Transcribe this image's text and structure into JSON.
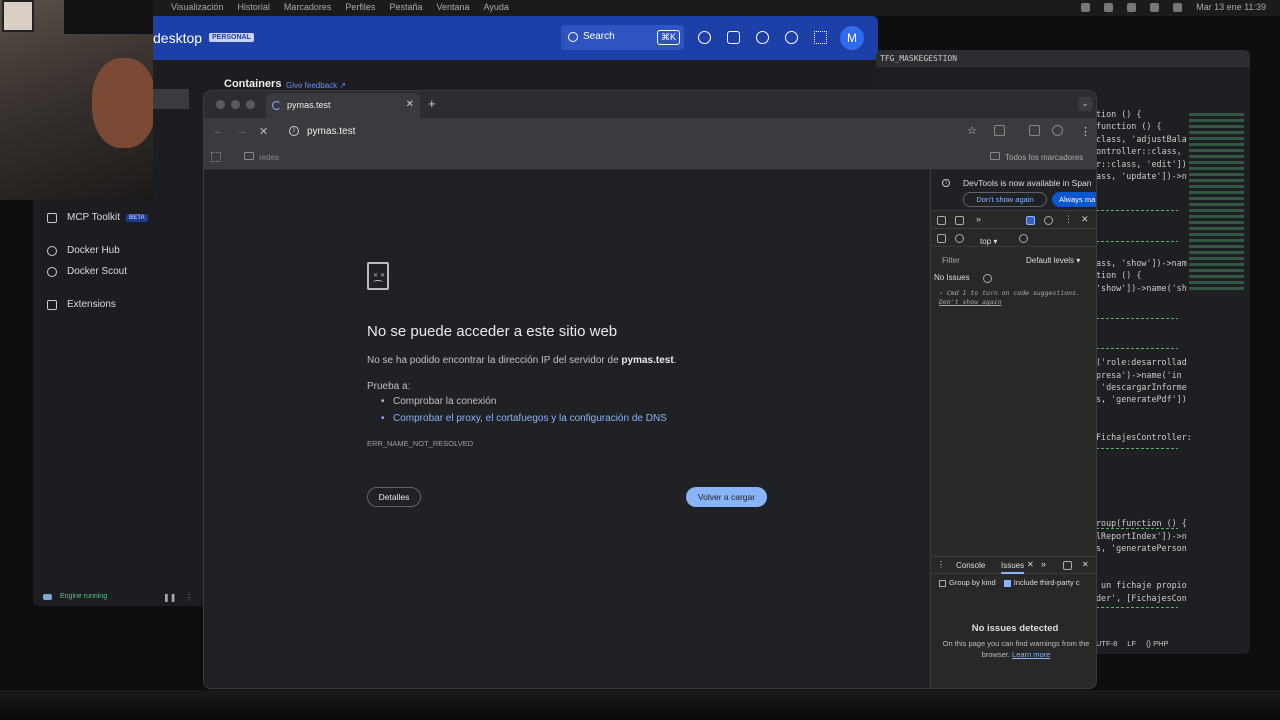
{
  "menubar": {
    "menus": [
      "Visualización",
      "Historial",
      "Marcadores",
      "Perfiles",
      "Pestaña",
      "Ventana",
      "Ayuda"
    ],
    "datetime": "Mar 13 ene  11:39"
  },
  "docker": {
    "brand": "desktop",
    "plan_badge": "PERSONAL",
    "search_label": "Search",
    "search_shortcut": "⌘K",
    "avatar_letter": "M",
    "section_title": "Containers",
    "feedback_link": "Give feedback ↗",
    "nav": [
      {
        "label": "MCP Toolkit",
        "badge": "BETA"
      },
      {
        "label": "Docker Hub"
      },
      {
        "label": "Docker Scout"
      },
      {
        "label": "Extensions"
      }
    ],
    "engine_status": "Engine running"
  },
  "editor": {
    "tab_name": "TFG_MASKEGESTION",
    "code_lines": [
      "tion () {",
      "function () {",
      "class, 'adjustBala",
      "ontroller::class,",
      "r::class, 'edit'])",
      "ass, 'update'])->n",
      "",
      "",
      "",
      "",
      "",
      "",
      "ass, 'show'])->nam",
      "tion () {",
      "'show'])->name('sh",
      "",
      "",
      "",
      "",
      "",
      "('role:desarrollad",
      "presa')->name('in",
      " 'descargarInforme",
      "s, 'generatePdf'])",
      "",
      "",
      "FichajesController:",
      "",
      "",
      "",
      "",
      "",
      "",
      "roup(function () {",
      "lReportIndex'])->n",
      "s, 'generatePerson",
      "",
      "",
      " un fichaje propio",
      "der', [FichajesCon",
      "",
      "",
      "",
      "",
      "",
      "_admin')->group(fu"
    ],
    "status_items": [
      "UTF-8",
      "LF",
      "{} PHP"
    ]
  },
  "chrome": {
    "tab_title": "pymas.test",
    "url": "pymas.test",
    "bookmark_folder": "redes",
    "all_bookmarks": "Todos los marcadores"
  },
  "error_page": {
    "title": "No se puede acceder a este sitio web",
    "desc_prefix": "No se ha podido encontrar la dirección IP del servidor de ",
    "host": "pymas.test",
    "desc_suffix": ".",
    "try_label": "Prueba a:",
    "suggestions": [
      "Comprobar la conexión",
      "Comprobar el proxy, el cortafuegos y la configuración de DNS"
    ],
    "error_code": "ERR_NAME_NOT_RESOLVED",
    "details_button": "Detalles",
    "reload_button": "Volver a cargar"
  },
  "devtools": {
    "banner_text": "DevTools is now available in Span",
    "dont_show": "Don't show again",
    "always": "Always ma",
    "context": "top ▾",
    "filter_placeholder": "Filter",
    "levels": "Default levels ▾",
    "no_issues": "No Issues",
    "hint_key": "Cmd",
    "hint_key2": "I",
    "hint_text": " to turn on code suggestions. ",
    "hint_link": "Don't show again",
    "drawer_tab_console": "Console",
    "drawer_tab_issues": "Issues",
    "group_by_kind": "Group by kind",
    "include_third": "Include third-party c",
    "no_issues_detected": "No issues detected",
    "no_issues_text": "On this page you can find warnings from the browser. ",
    "learn_more": "Learn more"
  }
}
